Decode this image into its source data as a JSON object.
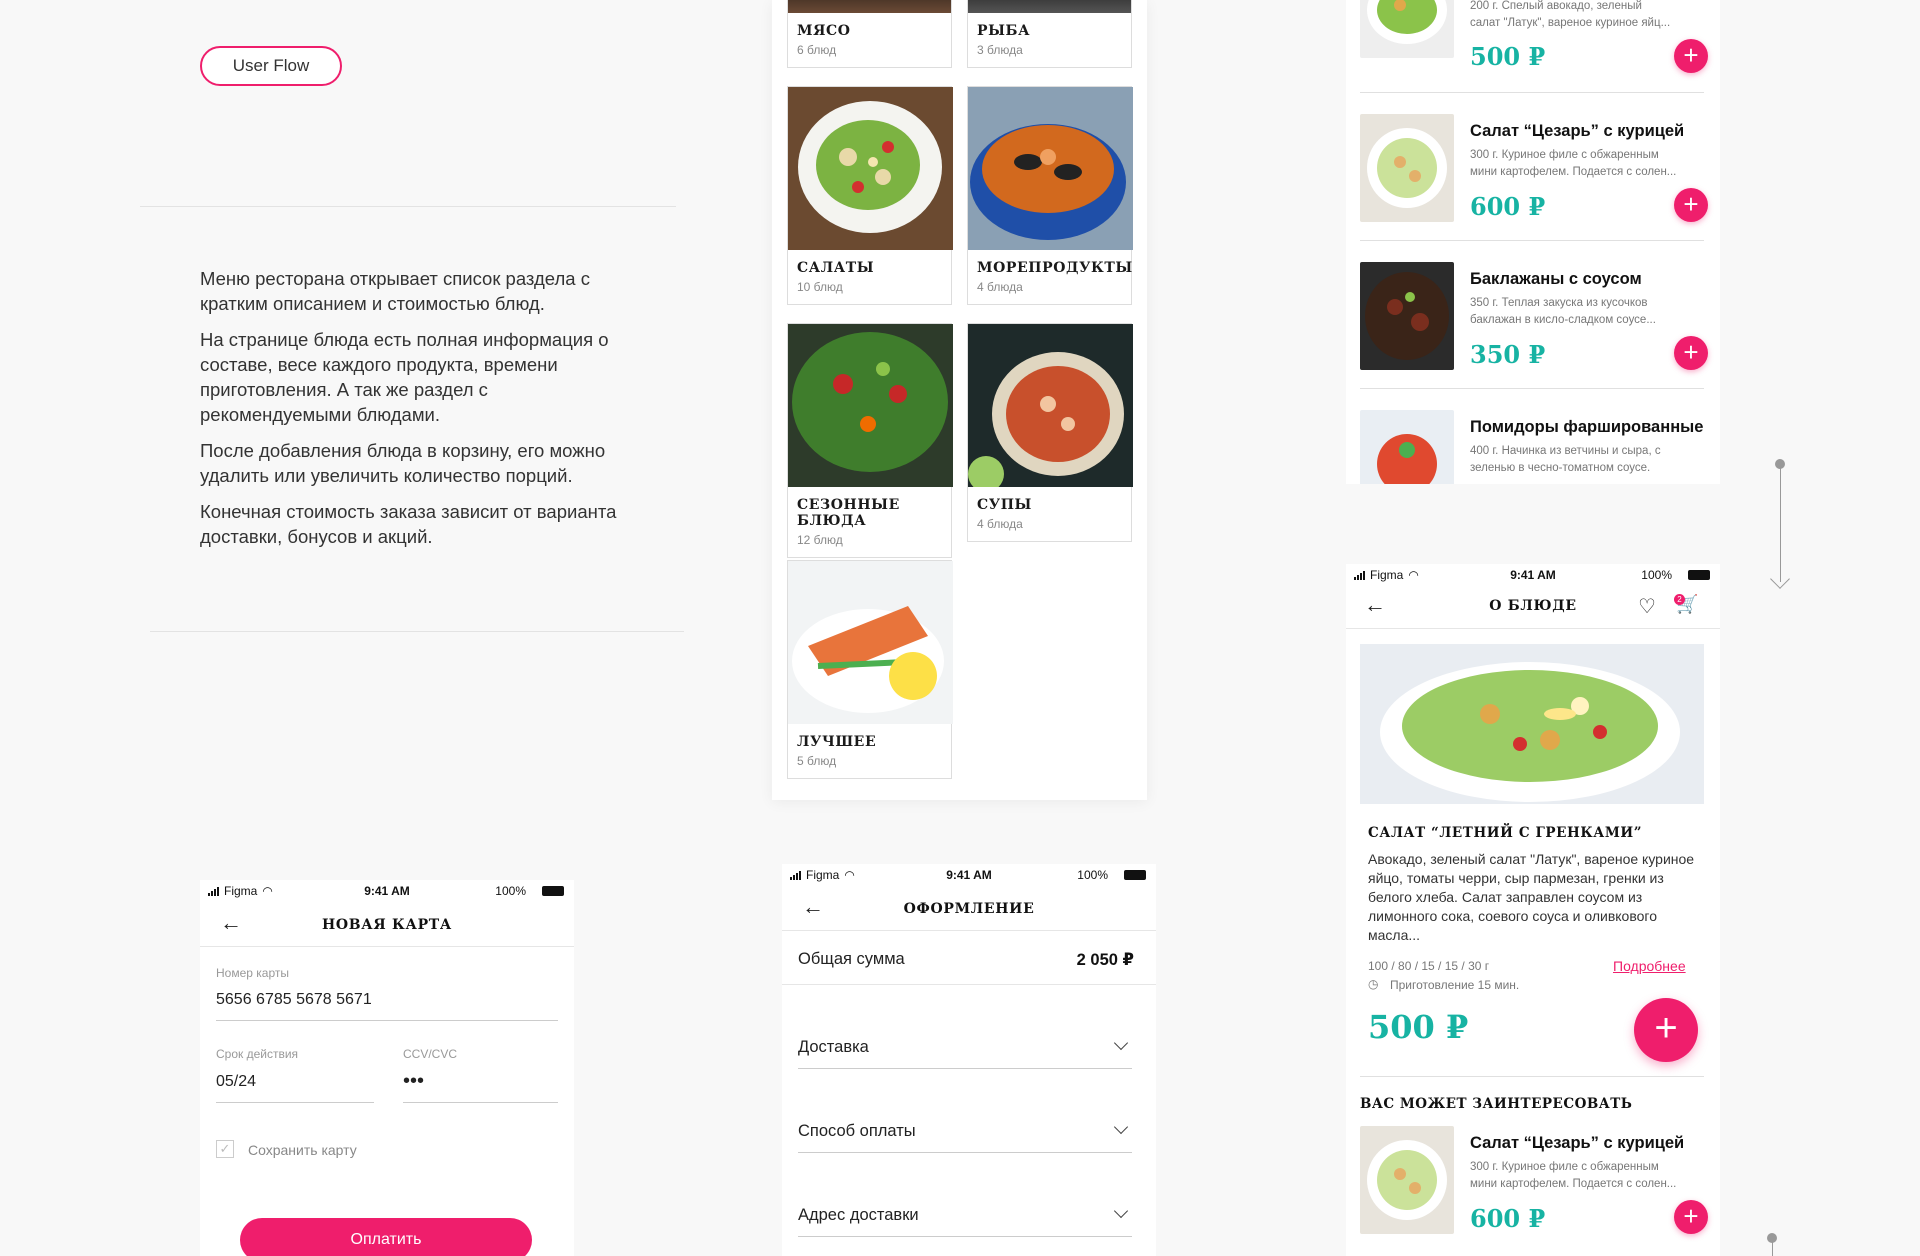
{
  "left": {
    "userflow_label": "User Flow",
    "paragraphs": [
      "Меню ресторана открывает список раздела с кратким описанием и стоимостью блюд.",
      "На странице блюда есть полная информация о составе, весе каждого продукта, времени приготовления. А так же раздел с рекомендуемыми блюдами.",
      "После добавления блюда в корзину, его можно удалить или увеличить количество порций.",
      "Конечная стоимость заказа зависит от варианта доставки, бонусов и акций."
    ]
  },
  "categories": [
    {
      "title": "МЯСО",
      "count": "6 блюд"
    },
    {
      "title": "РЫБА",
      "count": "3 блюда"
    },
    {
      "title": "САЛАТЫ",
      "count": "10 блюд"
    },
    {
      "title": "МОРЕПРОДУКТЫ",
      "count": "4 блюда"
    },
    {
      "title": "СЕЗОННЫЕ БЛЮДА",
      "count": "12 блюд"
    },
    {
      "title": "СУПЫ",
      "count": "4 блюда"
    },
    {
      "title": "ЛУЧШЕЕ",
      "count": "5 блюд"
    }
  ],
  "dish_list": {
    "first_info_tail": "200 г. Спелый авокадо, зеленый",
    "first_info_line2": "салат \"Латук\", вареное куриное яйц...",
    "first_price": "500 ₽",
    "items": [
      {
        "name": "Салат “Цезарь” с курицей",
        "info1": "300 г. Куриное филе с обжаренным",
        "info2": "мини картофелем. Подается с солен...",
        "price": "600 ₽"
      },
      {
        "name": "Баклажаны с соусом",
        "info1": "350 г. Теплая закуска из кусочков",
        "info2": "баклажан в кисло-сладком соусе...",
        "price": "350 ₽"
      },
      {
        "name": "Помидоры фаршированные",
        "info1": "400 г. Начинка из ветчины и сыра, с",
        "info2": "зеленью в чесно-томатном соусе.",
        "price": ""
      }
    ]
  },
  "status_bar": {
    "carrier": "Figma",
    "time": "9:41 AM",
    "battery": "100%"
  },
  "detail": {
    "nav_title": "О БЛЮДЕ",
    "cart_count": "2",
    "dish_title": "САЛАТ “ЛЕТНИЙ С ГРЕНКАМИ”",
    "description": "Авокадо, зеленый салат \"Латук\", вареное куриное яйцо, томаты черри, сыр пармезан, гренки из белого хлеба. Салат заправлен соусом из лимонного сока, соевого соуса и оливкового масла...",
    "weights": "100 / 80 / 15 / 15 / 30 г",
    "more_link": "Подробнее",
    "cook_time": "Приготовление 15 мин.",
    "price": "500 ₽",
    "recommend_title": "ВАС МОЖЕТ ЗАИНТЕРЕСОВАТЬ",
    "rec_item": {
      "name": "Салат “Цезарь” с курицей",
      "info1": "300 г. Куриное филе с обжаренным",
      "info2": "мини картофелем. Подается с солен...",
      "price": "600 ₽"
    }
  },
  "new_card": {
    "nav_title": "НОВАЯ КАРТА",
    "card_number_label": "Номер карты",
    "card_number": "5656 6785 5678 5671",
    "expiry_label": "Срок действия",
    "expiry": "05/24",
    "cvv_label": "CCV/CVC",
    "cvv": "•••",
    "save_label": "Сохранить карту",
    "pay_label": "Оплатить"
  },
  "checkout": {
    "nav_title": "ОФОРМЛЕНИЕ",
    "total_label": "Общая сумма",
    "total_value": "2 050 ₽",
    "delivery": "Доставка",
    "payment": "Способ оплаты",
    "address": "Адрес доставки"
  },
  "colors": {
    "accent": "#ef1e6c",
    "price": "#17b3a3"
  },
  "icons": [
    "back-arrow-icon",
    "heart-icon",
    "cart-icon",
    "clock-icon",
    "plus-icon",
    "chevron-down-icon",
    "checkbox-icon",
    "wifi-icon",
    "signal-icon",
    "battery-icon"
  ]
}
